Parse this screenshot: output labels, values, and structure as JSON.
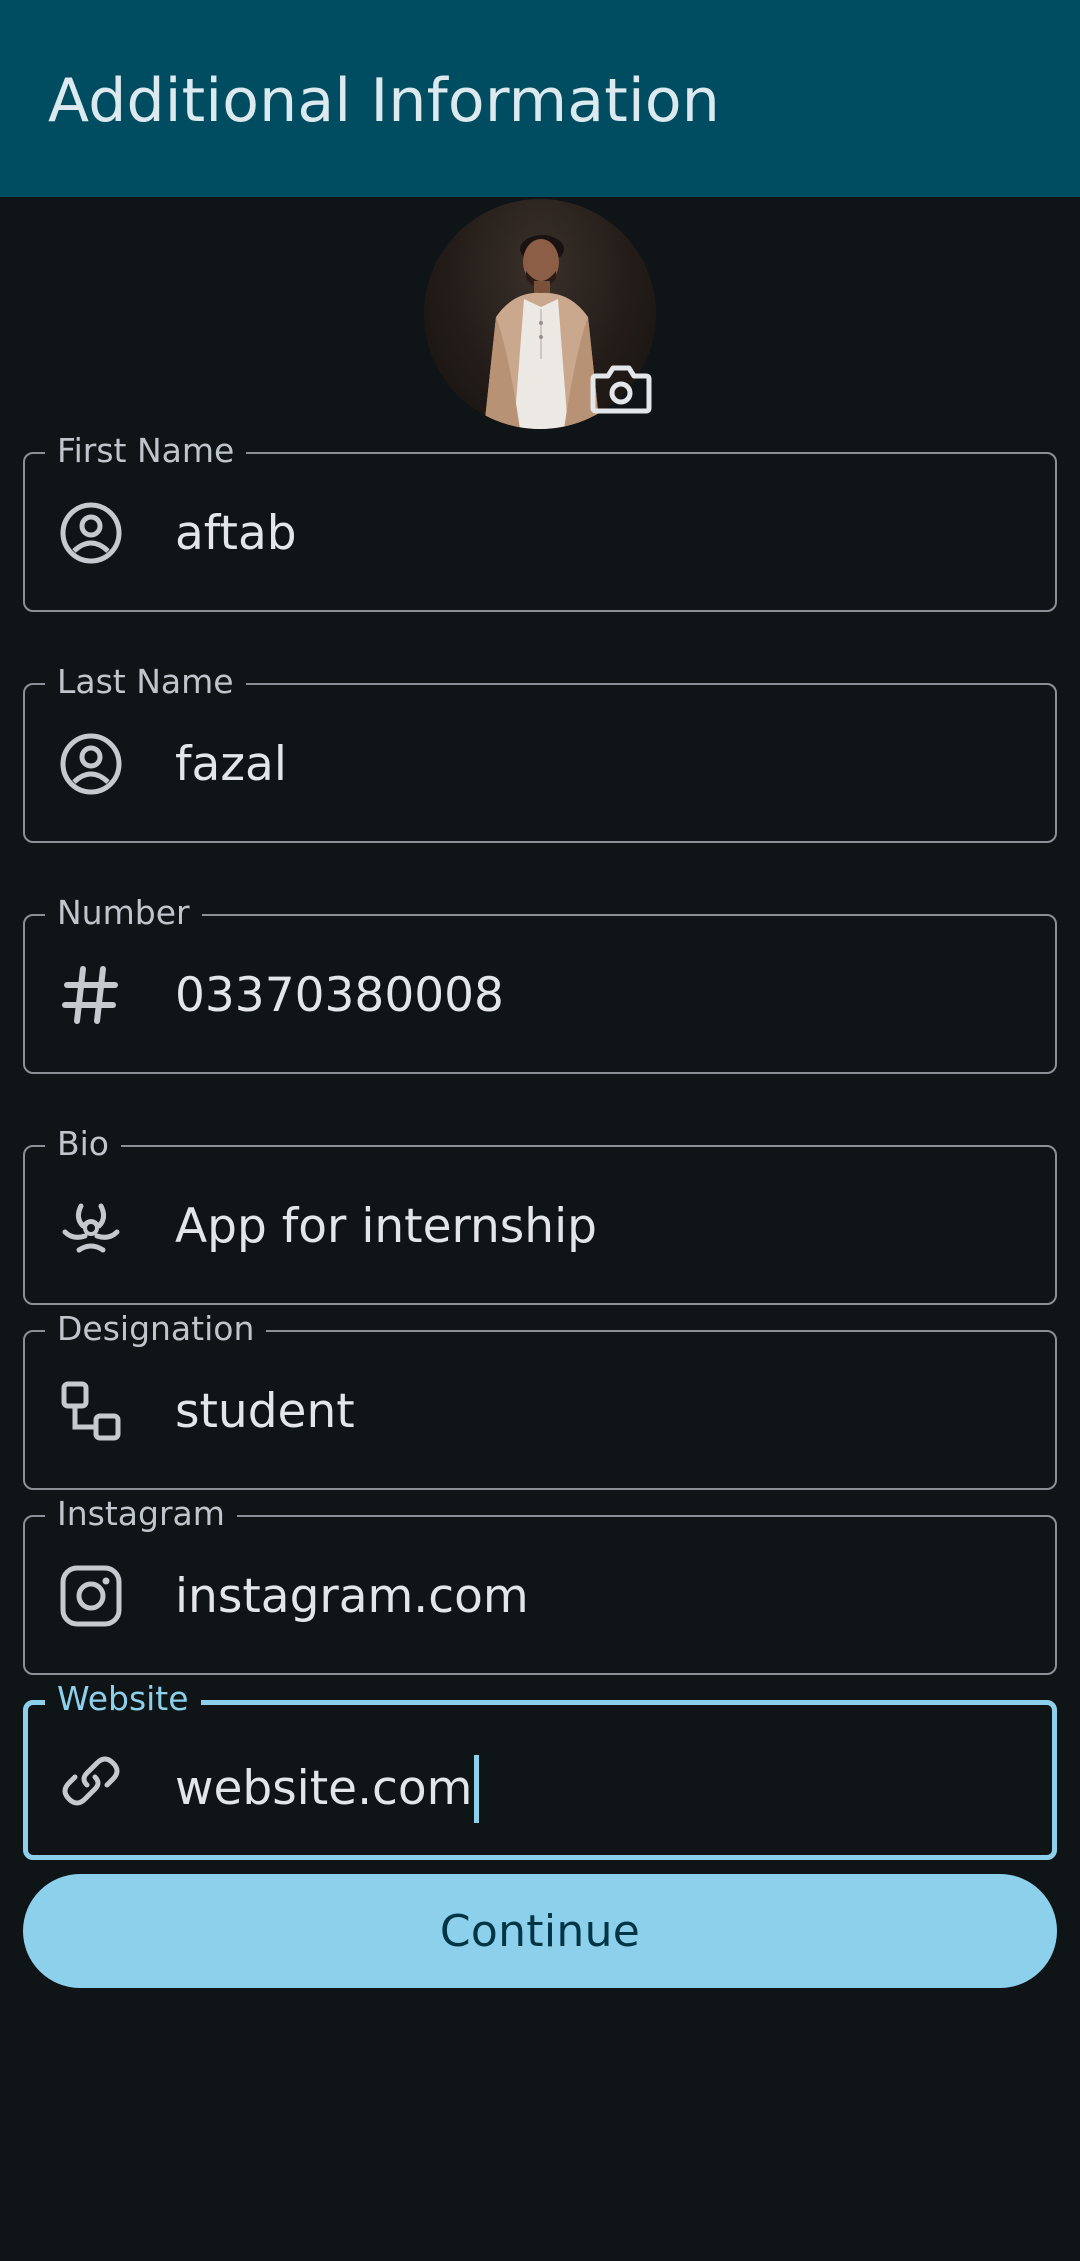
{
  "app_bar": {
    "title": "Additional Information"
  },
  "profile": {
    "photo_icon": "person-photo",
    "camera_icon": "camera-icon"
  },
  "fields": [
    {
      "label": "First Name",
      "value": "aftab",
      "icon": "account-circle-icon"
    },
    {
      "label": "Last Name",
      "value": "fazal",
      "icon": "account-circle-icon"
    },
    {
      "label": "Number",
      "value": "03370380008",
      "icon": "hash-icon"
    },
    {
      "label": "Bio",
      "value": "App for internship",
      "icon": "biohazard-icon"
    },
    {
      "label": "Designation",
      "value": "student",
      "icon": "flow-icon"
    },
    {
      "label": "Instagram",
      "value": "instagram.com",
      "icon": "instagram-icon"
    },
    {
      "label": "Website",
      "value": "website.com",
      "icon": "link-icon"
    }
  ],
  "continue_button": {
    "label": "Continue"
  },
  "colors": {
    "app_bar": "#004c61",
    "background": "#0f1417",
    "accent": "#8dd0ec",
    "outline": "#8a9095"
  }
}
